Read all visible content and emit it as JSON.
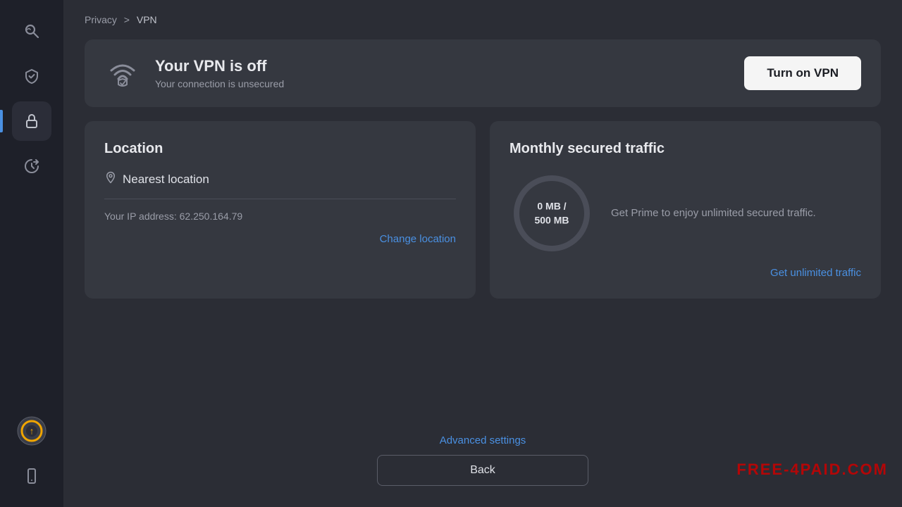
{
  "sidebar": {
    "items": [
      {
        "id": "search",
        "icon": "🔍",
        "active": false,
        "label": "Search"
      },
      {
        "id": "shield",
        "icon": "✓",
        "active": false,
        "label": "Shield"
      },
      {
        "id": "lock",
        "icon": "🔒",
        "active": true,
        "label": "Privacy"
      },
      {
        "id": "rocket",
        "icon": "🚀",
        "active": false,
        "label": "Speed"
      },
      {
        "id": "update",
        "icon": "⬆",
        "active": false,
        "label": "Update"
      },
      {
        "id": "mobile",
        "icon": "📱",
        "active": false,
        "label": "Mobile"
      }
    ]
  },
  "breadcrumb": {
    "parent": "Privacy",
    "separator": ">",
    "current": "VPN"
  },
  "vpn_status": {
    "title": "Your VPN is off",
    "subtitle": "Your connection is unsecured",
    "button_label": "Turn on VPN"
  },
  "location_card": {
    "title": "Location",
    "location_name": "Nearest location",
    "ip_label": "Your IP address: 62.250.164.79",
    "change_link": "Change location"
  },
  "traffic_card": {
    "title": "Monthly secured traffic",
    "used": "0 MB",
    "total": "500 MB",
    "circle_label_line1": "0 MB /",
    "circle_label_line2": "500 MB",
    "description": "Get Prime to enjoy unlimited secured traffic.",
    "get_link": "Get unlimited traffic"
  },
  "bottom": {
    "advanced_label": "Advanced settings",
    "back_label": "Back"
  },
  "watermark": "FREE-4PAID.COM"
}
